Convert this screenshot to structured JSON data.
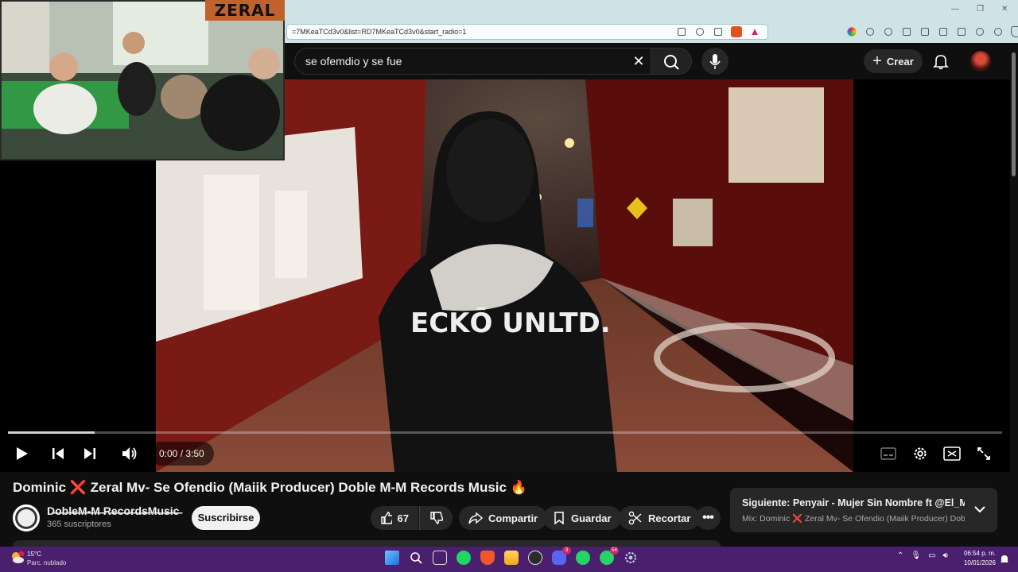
{
  "browser": {
    "url": "=7MKeaTCd3v0&list=RD7MKeaTCd3v0&start_radio=1"
  },
  "header": {
    "search_query": "se ofemdio y se fue",
    "create_label": "Crear"
  },
  "overlay": {
    "facecam_logo": "ZERAL",
    "shirt_text": "ECKŌ UNLTD."
  },
  "player": {
    "time": "0:00 / 3:50",
    "progress_fraction": 0.087
  },
  "video": {
    "title": "Dominic ❌ Zeral Mv- Se Ofendio (Maiik Producer) Doble M-M Records Music 🔥",
    "channel_name": "D̶o̶b̶l̶e̶M̶-̶M̶ ̶R̶e̶c̶o̶r̶d̶s̶M̶u̶s̶i̶c̶",
    "subscribers": "365 suscriptores",
    "subscribe_label": "Suscribirse",
    "like_count": "67",
    "share_label": "Compartir",
    "save_label": "Guardar",
    "clip_label": "Recortar"
  },
  "up_next": {
    "title": "Siguiente: Penyair - Mujer Sin Nombre ft @El_Muisc...",
    "subtitle": "Mix: Dominic ❌ Zeral Mv- Se Ofendio (Maiik Producer) Dobl..."
  },
  "taskbar": {
    "temperature": "15°C",
    "weather": "Parc. nublado",
    "time": "06:54 p. m.",
    "date": "10/01/2026",
    "badge_discord": "3",
    "badge_whatsapp": "54"
  }
}
